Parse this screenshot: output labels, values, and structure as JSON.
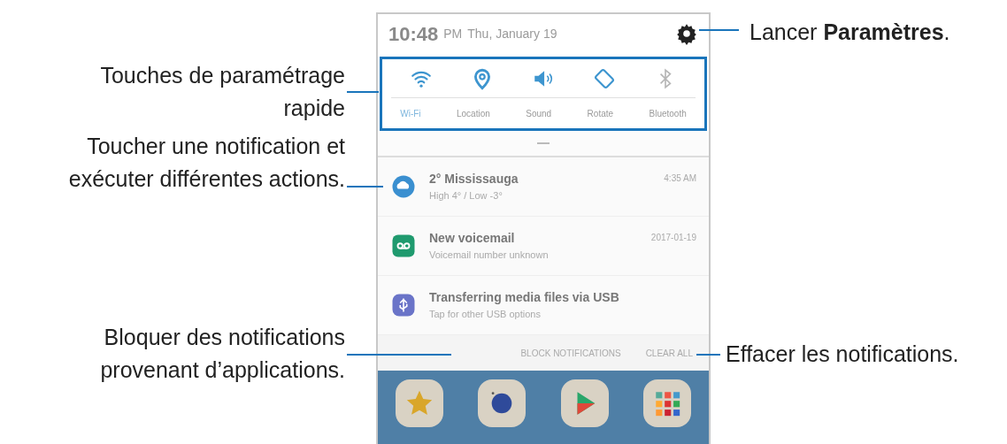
{
  "status": {
    "time": "10:48",
    "ampm": "PM",
    "date": "Thu, January 19"
  },
  "quick_settings": [
    {
      "label": "Wi-Fi",
      "on": true
    },
    {
      "label": "Location",
      "on": true
    },
    {
      "label": "Sound",
      "on": true
    },
    {
      "label": "Rotate",
      "on": true
    },
    {
      "label": "Bluetooth",
      "on": false
    }
  ],
  "notifications": [
    {
      "color": "#3a8fd0",
      "title": "2° Mississauga",
      "text": "High 4° / Low -3°",
      "time": "4:35 AM"
    },
    {
      "color": "#1f9a6e",
      "title": "New voicemail",
      "text": "Voicemail number unknown",
      "time": "2017-01-19"
    },
    {
      "color": "#6a74c8",
      "title": "Transferring media files via USB",
      "text": "Tap for other USB options"
    }
  ],
  "actions": [
    "BLOCK NOTIFICATIONS",
    "CLEAR ALL"
  ],
  "callouts": [
    {
      "text": "Lancer **Paramètres**."
    },
    {
      "text": "Touches de paramétrage\nrapide"
    },
    {
      "text": "Toucher une notification et\nexécuter différentes actions."
    },
    {
      "text": "Bloquer des notifications\nprovenant d’applications."
    },
    {
      "text": "Effacer les notifications."
    }
  ]
}
